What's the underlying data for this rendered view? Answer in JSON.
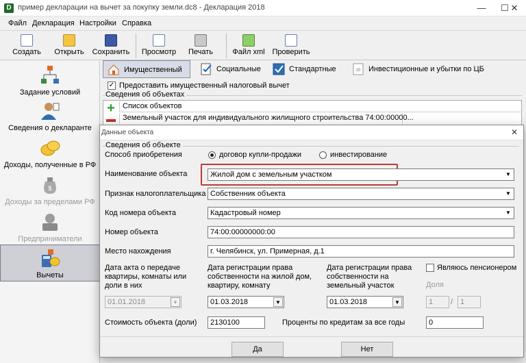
{
  "window": {
    "title": "пример декларации на вычет за покупку земли.dc8 - Декларация 2018",
    "app_icon": "D",
    "controls": {
      "minimize": "—",
      "maximize": "☐",
      "close": "✕"
    }
  },
  "menu": [
    "Файл",
    "Декларация",
    "Настройки",
    "Справка"
  ],
  "toolbar": {
    "create": "Создать",
    "open": "Открыть",
    "save": "Сохранить",
    "preview": "Просмотр",
    "print": "Печать",
    "xml": "Файл xml",
    "check": "Проверить"
  },
  "sidebar": {
    "conditions": "Задание условий",
    "declarant": "Сведения о декларанте",
    "income_rf": "Доходы, полученные в РФ",
    "income_abroad": "Доходы за пределами РФ",
    "entrepreneurs": "Предприниматели",
    "deductions": "Вычеты"
  },
  "tabs": {
    "property": "Имущественный",
    "social": "Социальные",
    "standard": "Стандартные",
    "investment": "Инвестиционные и убытки по ЦБ"
  },
  "main": {
    "provide_deduction": "Предоставить имущественный налоговый вычет",
    "provide_deduction_checked": true,
    "objects_group": "Сведения об объектах",
    "list_header": "Список объектов",
    "list_row": "Земельный участок для индивидуального жилищного строительства 74:00:00000..."
  },
  "dialog": {
    "title": "Данные объекта",
    "close": "✕",
    "group": "Сведения об объекте",
    "acq_method_label": "Способ приобретения",
    "acq_option_1": "договор купли-продажи",
    "acq_option_2": "инвестирование",
    "acq_selected": "договор купли-продажи",
    "name_label": "Наименование объекта",
    "name_value": "Жилой дом с земельным участком",
    "taxpayer_label": "Признак налогоплательщика",
    "taxpayer_value": "Собственник объекта",
    "code_label": "Код номера объекта",
    "code_value": "Кадастровый номер",
    "number_label": "Номер объекта",
    "number_value": "74:00:00000000:00",
    "location_label": "Место нахождения",
    "location_value": "г. Челябинск, ул. Примерная, д.1",
    "act_date_label": "Дата акта о передаче квартиры, комнаты или доли в них",
    "act_date_value": "01.01.2018",
    "house_reg_label": "Дата регистрации права собственности на жилой дом, квартиру, комнату",
    "house_reg_value": "01.03.2018",
    "land_reg_label": "Дата регистрации права собственности на земельный участок",
    "land_reg_value": "01.03.2018",
    "pensioner_label": "Являюсь пенсионером",
    "pensioner_checked": false,
    "share_label": "Доля",
    "share_num": "1",
    "share_sep": "/",
    "share_den": "1",
    "cost_label": "Стоимость объекта (доли)",
    "cost_value": "2130100",
    "interest_label": "Проценты по кредитам за все годы",
    "interest_value": "0",
    "yes": "Да",
    "no": "Нет"
  },
  "colors": {
    "highlight": "#c0393b",
    "active_side": "#cfcfd6",
    "add_green": "#2e9c2e",
    "remove_red": "#c9302c"
  }
}
